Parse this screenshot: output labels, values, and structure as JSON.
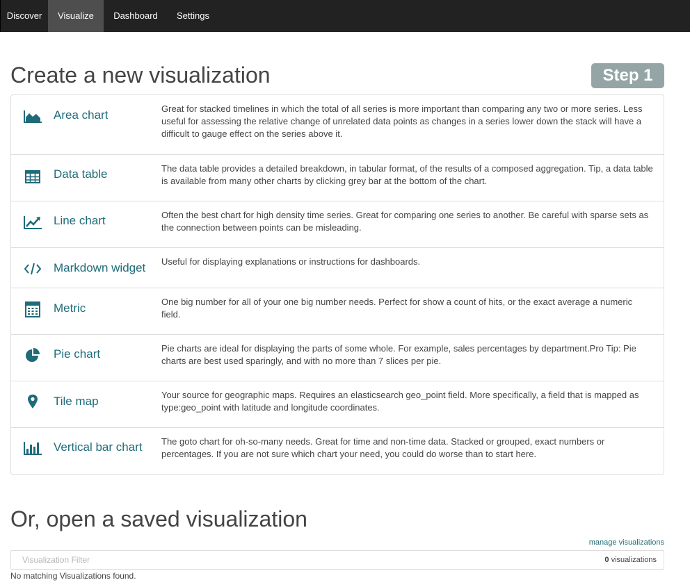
{
  "nav": {
    "tabs": [
      {
        "label": "Discover"
      },
      {
        "label": "Visualize",
        "active": true
      },
      {
        "label": "Dashboard"
      },
      {
        "label": "Settings"
      }
    ]
  },
  "header": {
    "title": "Create a new visualization",
    "step": "Step 1"
  },
  "visualizations": [
    {
      "icon": "area-chart-icon",
      "name": "Area chart",
      "description": "Great for stacked timelines in which the total of all series is more important than comparing any two or more series. Less useful for assessing the relative change of unrelated data points as changes in a series lower down the stack will have a difficult to gauge effect on the series above it."
    },
    {
      "icon": "table-icon",
      "name": "Data table",
      "description": "The data table provides a detailed breakdown, in tabular format, of the results of a composed aggregation. Tip, a data table is available from many other charts by clicking grey bar at the bottom of the chart."
    },
    {
      "icon": "line-chart-icon",
      "name": "Line chart",
      "description": "Often the best chart for high density time series. Great for comparing one series to another. Be careful with sparse sets as the connection between points can be misleading."
    },
    {
      "icon": "code-icon",
      "name": "Markdown widget",
      "description": "Useful for displaying explanations or instructions for dashboards."
    },
    {
      "icon": "calculator-icon",
      "name": "Metric",
      "description": "One big number for all of your one big number needs. Perfect for show a count of hits, or the exact average a numeric field."
    },
    {
      "icon": "pie-chart-icon",
      "name": "Pie chart",
      "description": "Pie charts are ideal for displaying the parts of some whole. For example, sales percentages by department.Pro Tip: Pie charts are best used sparingly, and with no more than 7 slices per pie."
    },
    {
      "icon": "map-marker-icon",
      "name": "Tile map",
      "description": "Your source for geographic maps. Requires an elasticsearch geo_point field. More specifically, a field that is mapped as type:geo_point with latitude and longitude coordinates."
    },
    {
      "icon": "bar-chart-icon",
      "name": "Vertical bar chart",
      "description": "The goto chart for oh-so-many needs. Great for time and non-time data. Stacked or grouped, exact numbers or percentages. If you are not sure which chart your need, you could do worse than to start here."
    }
  ],
  "saved": {
    "title": "Or, open a saved visualization",
    "manage_link": "manage visualizations",
    "filter_placeholder": "Visualization Filter",
    "filter_value": "",
    "count": "0",
    "count_label": "visualizations",
    "empty_message": "No matching Visualizations found."
  },
  "colors": {
    "navbar": "#222222",
    "active_tab": "#4e4e4e",
    "accent": "#1f6b7a",
    "step_badge": "#95a5a6"
  }
}
